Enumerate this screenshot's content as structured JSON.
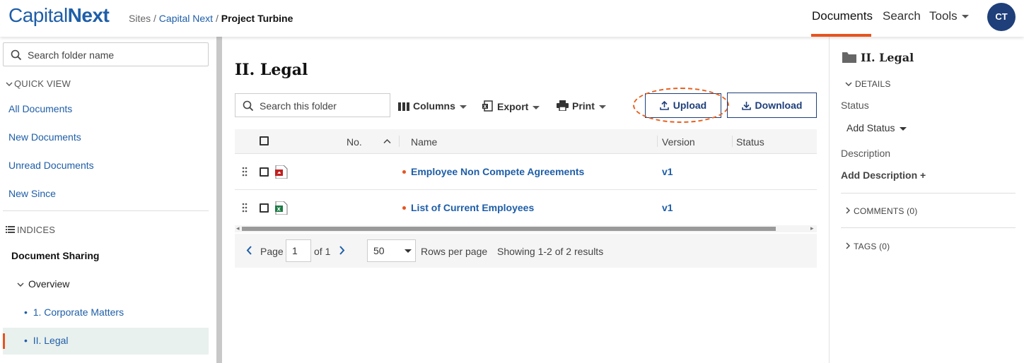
{
  "header": {
    "logo_regular": "Capital",
    "logo_bold": "Next",
    "breadcrumb": {
      "root": "Sites",
      "sep": "/",
      "site": "Capital Next",
      "current": "Project Turbine"
    },
    "nav": {
      "documents": "Documents",
      "search": "Search",
      "tools": "Tools"
    },
    "avatar_initials": "CT",
    "accent_color": "#e8531e",
    "brand_color": "#1e5ea8"
  },
  "sidebar": {
    "search_placeholder": "Search folder name",
    "quick_view_label": "QUICK VIEW",
    "quick_view_items": [
      "All Documents",
      "New Documents",
      "Unread Documents",
      "New Since"
    ],
    "indices_label": "INDICES",
    "group_title": "Document Sharing",
    "overview_label": "Overview",
    "sub_items": [
      "1. Corporate Matters",
      "II. Legal"
    ]
  },
  "main": {
    "folder_title": "II. Legal",
    "search_placeholder": "Search this folder",
    "toolbar": {
      "columns": "Columns",
      "export": "Export",
      "print": "Print",
      "upload": "Upload",
      "download": "Download"
    },
    "columns": {
      "no": "No.",
      "name": "Name",
      "version": "Version",
      "status": "Status"
    },
    "rows": [
      {
        "name": "Employee Non Compete Agreements",
        "version": "v1",
        "file_icon": "pdf-file-icon"
      },
      {
        "name": "List of Current Employees",
        "version": "v1",
        "file_icon": "excel-file-icon"
      }
    ],
    "pager": {
      "page_label": "Page",
      "page_value": "1",
      "of_label": "of 1",
      "rows_value": "50",
      "rows_label": "Rows per page",
      "showing": "Showing 1-2 of 2 results"
    }
  },
  "details_panel": {
    "title": "II. Legal",
    "details_label": "DETAILS",
    "status_label": "Status",
    "add_status": "Add Status",
    "description_label": "Description",
    "add_description": "Add Description +",
    "comments_label": "COMMENTS (0)",
    "tags_label": "TAGS (0)"
  }
}
